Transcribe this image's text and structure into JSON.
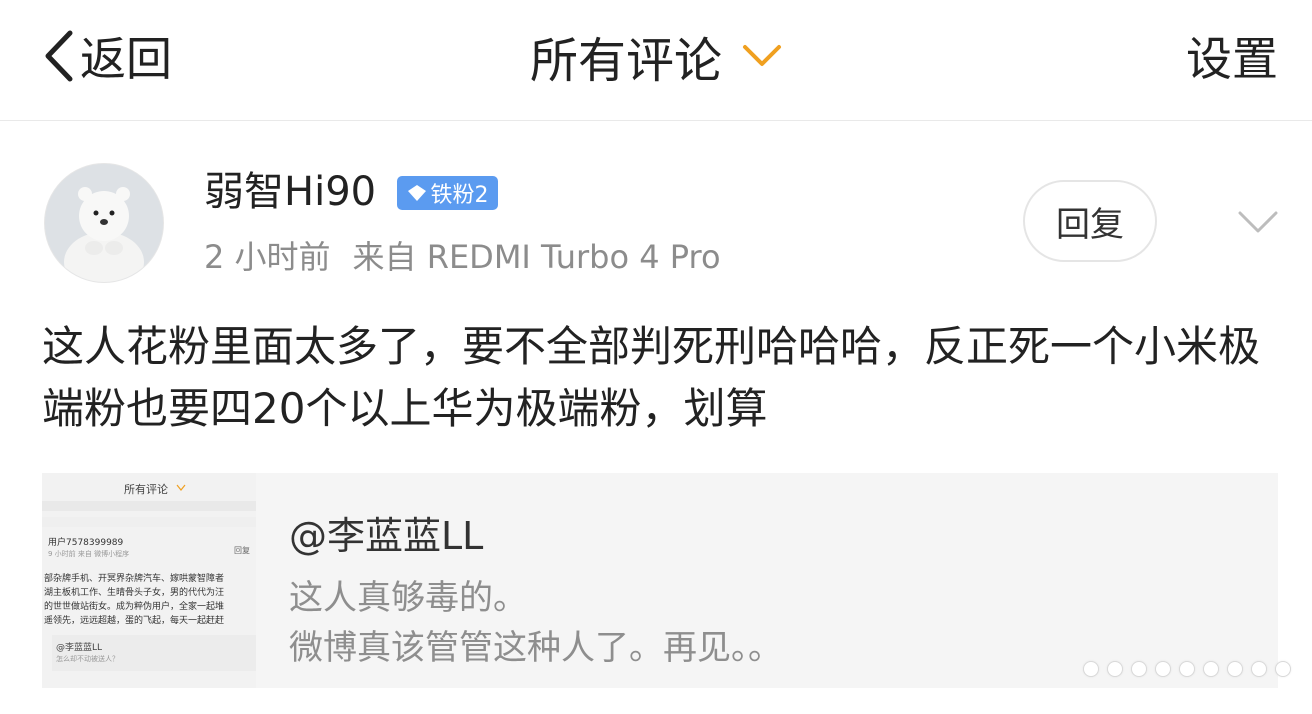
{
  "header": {
    "back_label": "返回",
    "title": "所有评论",
    "settings_label": "设置",
    "accent_color": "#f0a020"
  },
  "comment": {
    "username": "弱智Hi90",
    "badge": "铁粉2",
    "time": "2 小时前",
    "source": "来自 REDMI Turbo 4 Pro",
    "reply_label": "回复",
    "text": "这人花粉里面太多了，要不全部判死刑哈哈哈，反正死一个小米极端粉也要四20个以上华为极端粉，划算",
    "avatar_icon": "polar-bear-avatar",
    "badge_color": "#5b9bf0"
  },
  "quote": {
    "mention": "@李蓝蓝LL",
    "line1": "这人真够毒的。",
    "line2": "微博真该管管这种人了。再见。。",
    "thumb": {
      "title": "所有评论",
      "user": "用户7578399989",
      "meta": "9 小时前  来自 微博小程序",
      "reply": "回复",
      "lines": [
        "部杂牌手机、开冥界杂牌汽车、嫁哄蒙智障者",
        "湖主板机工作、生晴骨头子女，男的代代为汪",
        "的世世做站街女。成为粹伪用户，全家一起堆",
        "遥领先，远远超越，蛋的飞起，每天一起赶赶"
      ],
      "mention": "@李蓝蓝LL",
      "quote": "怎么却不动被送人？"
    }
  }
}
